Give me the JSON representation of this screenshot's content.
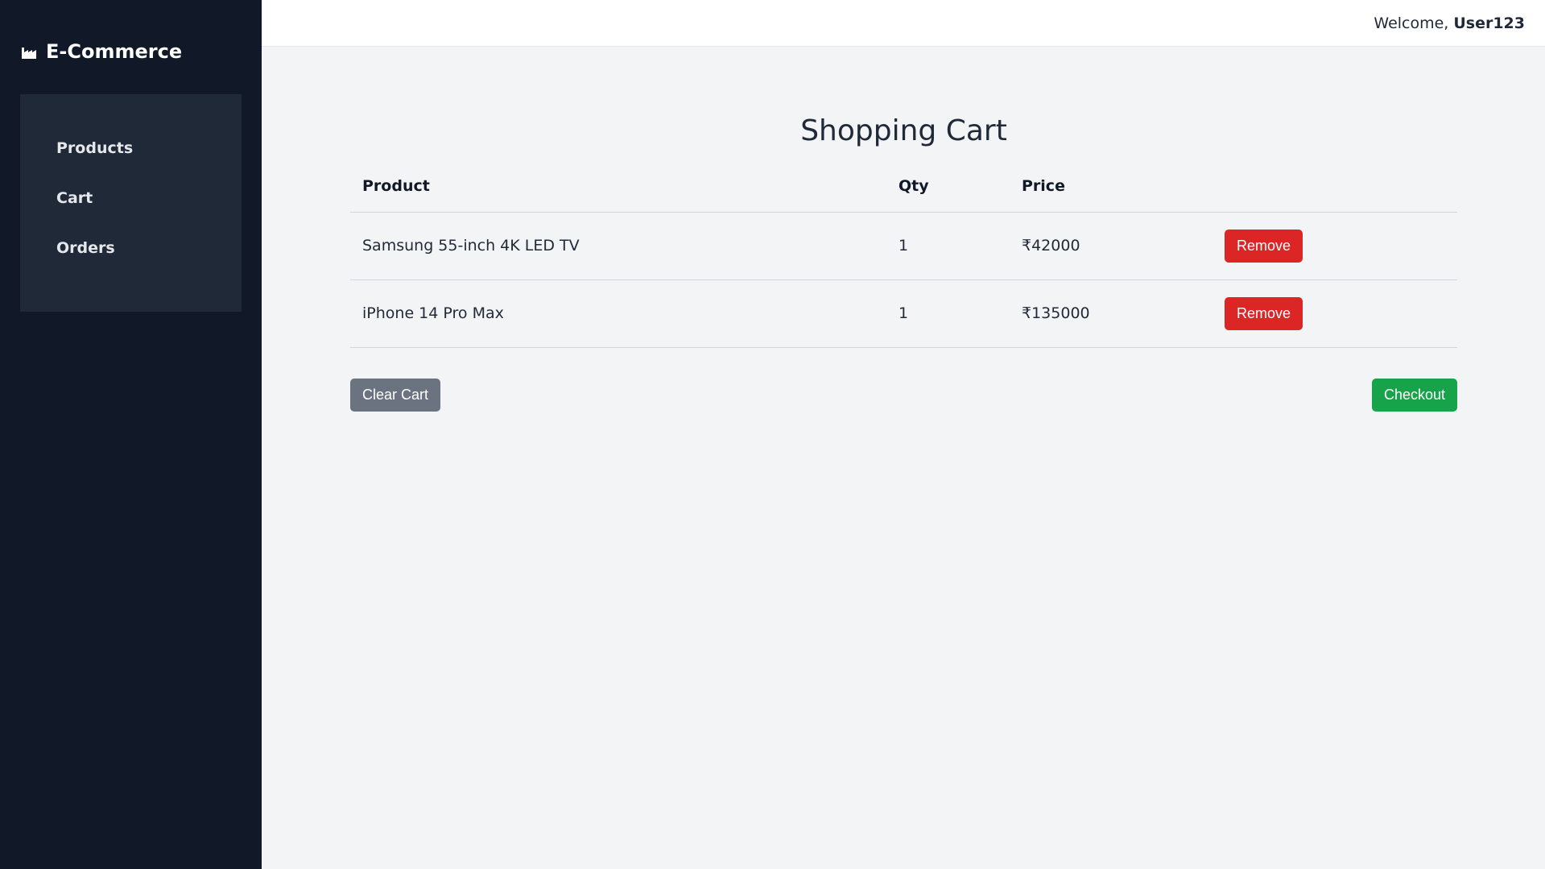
{
  "sidebar": {
    "brand": "E-Commerce",
    "brand_icon": "factory-icon",
    "items": [
      {
        "label": "Products"
      },
      {
        "label": "Cart"
      },
      {
        "label": "Orders"
      }
    ]
  },
  "topbar": {
    "welcome": "Welcome,",
    "username": "User123"
  },
  "main": {
    "title": "Shopping Cart",
    "columns": [
      "Product",
      "Qty",
      "Price",
      ""
    ],
    "rows": [
      {
        "product": "Samsung 55-inch 4K LED TV",
        "qty": "1",
        "price": "₹42000",
        "action": "Remove"
      },
      {
        "product": "iPhone 14 Pro Max",
        "qty": "1",
        "price": "₹135000",
        "action": "Remove"
      }
    ],
    "clear_label": "Clear Cart",
    "checkout_label": "Checkout"
  },
  "colors": {
    "sidebar_bg": "#111827",
    "nav_panel_bg": "#1f2937",
    "remove": "#dc2626",
    "clear": "#6b7280",
    "checkout": "#16a34a"
  }
}
